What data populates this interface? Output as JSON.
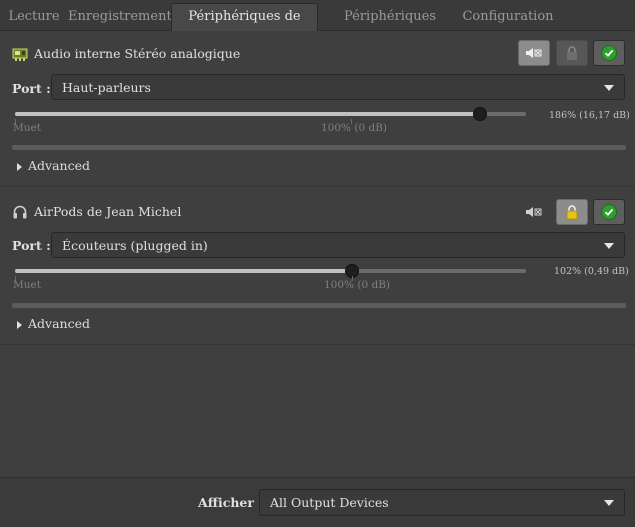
{
  "tabs": [
    {
      "label": "Lecture",
      "active": false
    },
    {
      "label": "Enregistrement",
      "active": false
    },
    {
      "label": "Périphériques de sortie",
      "active": true
    },
    {
      "label": "Périphériques d'entrée",
      "active": false
    },
    {
      "label": "Configuration",
      "active": false
    }
  ],
  "devices": [
    {
      "name": "Audio interne Stéréo analogique",
      "icon": "sound-card-icon",
      "port_label": "Port :",
      "port_value": "Haut-parleurs",
      "volume_fraction": 0.91,
      "volume_text": "186% (16,17 dB)",
      "mark_mute": "Muet",
      "mark_100": "100% (0 dB)",
      "advanced_label": "Advanced",
      "mute_active": true,
      "lock_active": false,
      "default_active": true
    },
    {
      "name": "AirPods de Jean Michel",
      "icon": "headphones-icon",
      "port_label": "Port :",
      "port_value": "Écouteurs (plugged in)",
      "volume_fraction": 0.66,
      "volume_text": "102% (0,49 dB)",
      "mark_mute": "Muet",
      "mark_100": "100% (0 dB)",
      "advanced_label": "Advanced",
      "mute_active": false,
      "lock_active": true,
      "default_active": true
    }
  ],
  "footer": {
    "show_label": "Afficher :",
    "show_value": "All Output Devices"
  },
  "colors": {
    "background": "#3c3c3c",
    "panel": "#3f3f3f",
    "slider_fill": "#c0c0c0",
    "check_green": "#2e9e2e",
    "lock_yellow": "#e8c11a"
  }
}
